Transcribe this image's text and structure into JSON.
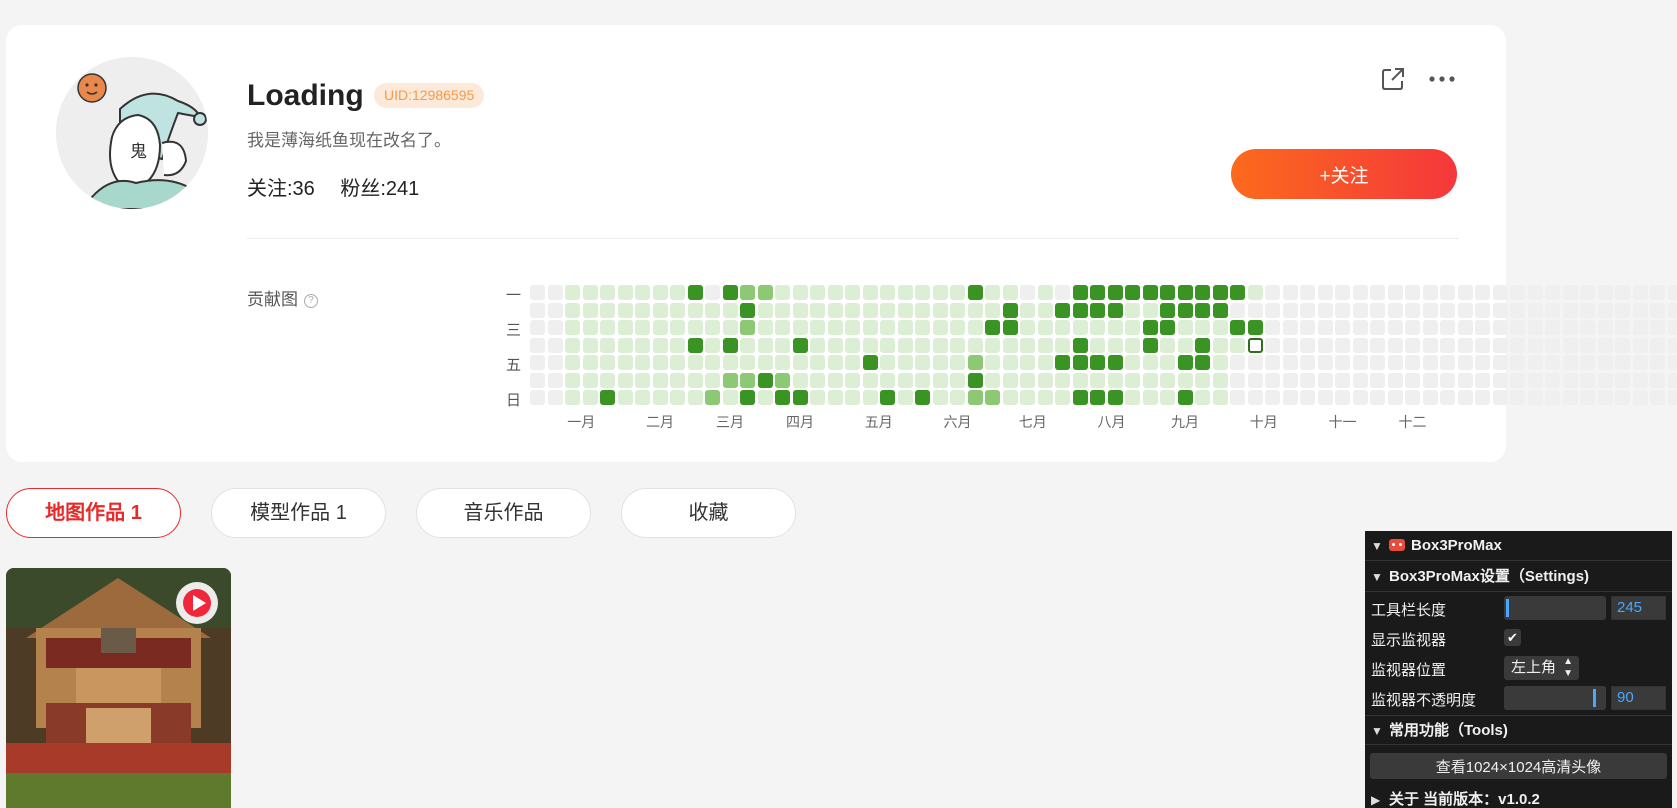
{
  "profile": {
    "username": "Loading",
    "uid": "UID:12986595",
    "bio": "我是薄海纸鱼现在改名了。",
    "following": "关注:36",
    "followers": "粉丝:241",
    "follow_button": "+关注"
  },
  "contribution": {
    "label": "贡献图",
    "help": "?",
    "weekdays": [
      "一",
      "三",
      "五",
      "日"
    ],
    "months": [
      "一月",
      "二月",
      "三月",
      "四月",
      "五月",
      "六月",
      "七月",
      "八月",
      "九月",
      "十月",
      "十一",
      "十二"
    ],
    "level_colors": [
      "#efefef",
      "#dcefd4",
      "#8dc874",
      "#3a9424"
    ],
    "grid": [
      "0011111113032211111111111311010333333333310000000000000000000000000000",
      "0011111111113111111111111113113333113333000000000000000000000000000000",
      "0011111111112111111111111133111111133111330000000000000000000000000000",
      "0011111113131113111111111111111311131131140000000000000000000000000000",
      "0011111111111111111311111211113333111331000000000000000000000000000000",
      "0011111111122321111111111311111111111111000000000000000000000000000000",
      "0011311111213133111131311221111333111311000000000000000000000000000000"
    ]
  },
  "tabs": [
    "地图作品 1",
    "模型作品 1",
    "音乐作品",
    "收藏"
  ],
  "panel": {
    "title": "Box3ProMax",
    "settings_header": "Box3ProMax设置（Settings)",
    "toolbar_length_label": "工具栏长度",
    "toolbar_length_value": "245",
    "toolbar_length_level": 0.02,
    "show_monitor_label": "显示监视器",
    "show_monitor_checked": "✔",
    "monitor_position_label": "监视器位置",
    "monitor_position_value": "左上角",
    "monitor_opacity_label": "监视器不透明度",
    "monitor_opacity_value": "90",
    "monitor_opacity_level": 0.9,
    "tools_header": "常用功能（Tools)",
    "avatar_button": "查看1024×1024高清头像",
    "about_header": "关于 当前版本：v1.0.2"
  }
}
